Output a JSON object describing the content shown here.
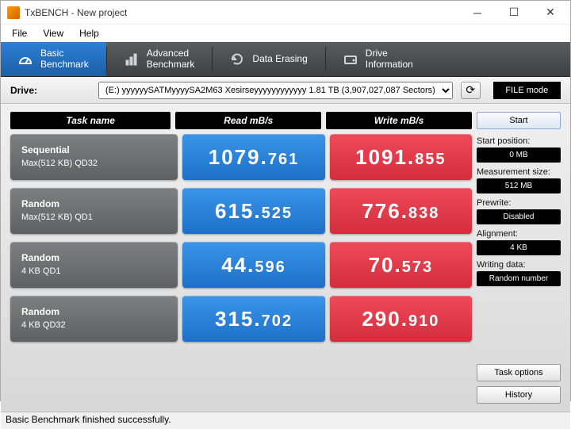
{
  "window": {
    "title": "TxBENCH - New project"
  },
  "menu": {
    "file": "File",
    "view": "View",
    "help": "Help"
  },
  "tabs": {
    "basic": "Basic\nBenchmark",
    "advanced": "Advanced\nBenchmark",
    "erase": "Data Erasing",
    "info": "Drive\nInformation"
  },
  "drive": {
    "label": "Drive:",
    "selected": "(E:) yyyyyySATMyyyySA2M63 Xesirseyyyyyyyyyyyy   1.81 TB (3,907,027,087 Sectors)",
    "filemode": "FILE mode"
  },
  "headers": {
    "task": "Task name",
    "read": "Read mB/s",
    "write": "Write mB/s"
  },
  "rows": [
    {
      "name": "Sequential",
      "sub": "Max(512 KB) QD32",
      "read": "1079.761",
      "write": "1091.855"
    },
    {
      "name": "Random",
      "sub": "Max(512 KB) QD1",
      "read": "615.525",
      "write": "776.838"
    },
    {
      "name": "Random",
      "sub": "4 KB QD1",
      "read": "44.596",
      "write": "70.573"
    },
    {
      "name": "Random",
      "sub": "4 KB QD32",
      "read": "315.702",
      "write": "290.910"
    }
  ],
  "side": {
    "start": "Start",
    "startpos_lbl": "Start position:",
    "startpos": "0 MB",
    "meas_lbl": "Measurement size:",
    "meas": "512 MB",
    "prewrite_lbl": "Prewrite:",
    "prewrite": "Disabled",
    "align_lbl": "Alignment:",
    "align": "4 KB",
    "writing_lbl": "Writing data:",
    "writing": "Random number",
    "taskopt": "Task options",
    "history": "History"
  },
  "status": "Basic Benchmark finished successfully."
}
